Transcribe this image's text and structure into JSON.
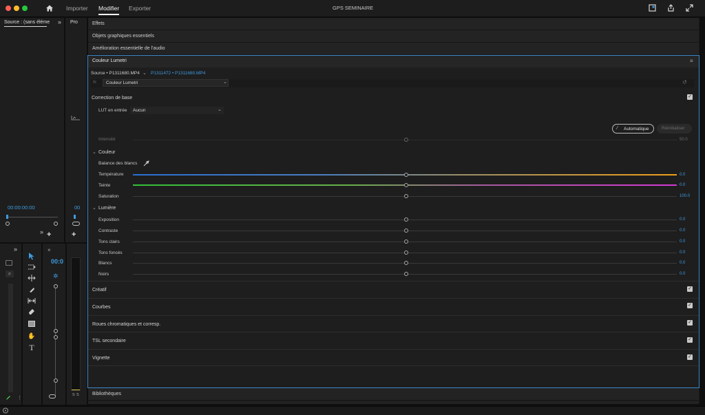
{
  "app": {
    "title": "GPS SEMINAIRE",
    "nav": [
      "Importer",
      "Modifier",
      "Exporter"
    ]
  },
  "source_panel": {
    "tab": "Source : (sans éléme",
    "timecode": "00:00:00:00"
  },
  "program_panel": {
    "tab": "Pro",
    "timecode": "00"
  },
  "timeline_panel": {
    "timecode": "00:0"
  },
  "rows": {
    "effects": "Effets",
    "graphics": "Objets graphiques essentiels",
    "audio": "Amélioration essentielle de l'audio",
    "lumetri": "Couleur Lumetri",
    "libraries": "Bibliothèques"
  },
  "lumetri": {
    "source_label": "Source • P1311680.MP4",
    "clip_label": "P1311472 • P1311680.MP4",
    "fx_label": "fx",
    "effect_select": "Couleur Lumetri",
    "basic_correction": "Correction de base",
    "lut_label": "LUT en entrée",
    "lut_value": "Aucun",
    "auto_button": "Automatique",
    "reset_button": "Réinitialiser",
    "intensity_label": "Intensité",
    "intensity_value": "50.0",
    "color_header": "Couleur",
    "white_balance": "Balance des blancs",
    "sliders_color": [
      {
        "label": "Température",
        "value": "0.0"
      },
      {
        "label": "Teinte",
        "value": "0.0"
      },
      {
        "label": "Saturation",
        "value": "100.0"
      }
    ],
    "light_header": "Lumière",
    "sliders_light": [
      {
        "label": "Exposition",
        "value": "0.0"
      },
      {
        "label": "Contraste",
        "value": "0.0"
      },
      {
        "label": "Tons clairs",
        "value": "0.0"
      },
      {
        "label": "Tons foncés",
        "value": "0.0"
      },
      {
        "label": "Blancs",
        "value": "0.0"
      },
      {
        "label": "Noirs",
        "value": "0.0"
      }
    ],
    "sections": [
      "Créatif",
      "Courbes",
      "Roues chromatiques et corresp.",
      "TSL secondaire",
      "Vignette"
    ]
  },
  "meter_labels": [
    "S",
    "S"
  ],
  "colors": {
    "accent_blue": "#3f9be0",
    "temp_start": "#2a6fd6",
    "temp_end": "#f0a018",
    "tint_start": "#33c23a",
    "tint_end": "#d63ad6"
  },
  "icons": [
    "home-icon",
    "panel-icon",
    "share-icon",
    "fullscreen-icon",
    "menu-icon",
    "selection-tool-icon",
    "track-select-icon",
    "ripple-icon",
    "razor-icon",
    "slip-icon",
    "pen-icon",
    "rectangle-icon",
    "hand-icon",
    "type-icon"
  ]
}
